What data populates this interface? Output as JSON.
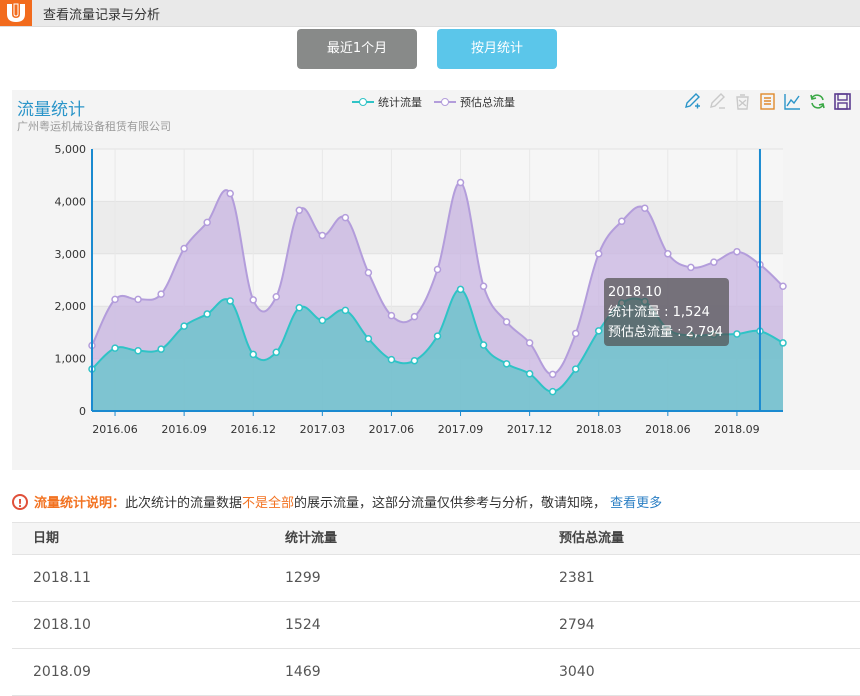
{
  "app": {
    "title": "查看流量记录与分析",
    "logo_icon": "brand-u-logo"
  },
  "tabs": {
    "recent": "最近1个月",
    "monthly": "按月统计"
  },
  "colors": {
    "primary_series": "#2fc3c6",
    "secondary_series": "#b39ddb",
    "accent": "#5bc6ea",
    "brand": "#f26b1d"
  },
  "toolbox": [
    "mark-pen-icon",
    "undo-mark-icon",
    "clear-mark-icon",
    "data-view-icon",
    "line-chart-icon",
    "refresh-icon",
    "save-image-icon"
  ],
  "chart": {
    "title": "流量统计",
    "subtitle": "广州粤运机械设备租赁有限公司",
    "tooltip": {
      "period": "2018.10",
      "line1": "统计流量 : 1,524",
      "line2": "预估总流量 : 2,794"
    }
  },
  "chart_data": {
    "type": "area",
    "title": "流量统计",
    "ylim": [
      0,
      5000
    ],
    "yticks": [
      "0",
      "1,000",
      "2,000",
      "3,000",
      "4,000",
      "5,000"
    ],
    "xticks": [
      "2016.06",
      "2016.09",
      "2016.12",
      "2017.03",
      "2017.06",
      "2017.09",
      "2017.12",
      "2018.03",
      "2018.06",
      "2018.09"
    ],
    "x": [
      "2016.05",
      "2016.06",
      "2016.07",
      "2016.08",
      "2016.09",
      "2016.10",
      "2016.11",
      "2016.12",
      "2017.01",
      "2017.02",
      "2017.03",
      "2017.04",
      "2017.05",
      "2017.06",
      "2017.07",
      "2017.08",
      "2017.09",
      "2017.10",
      "2017.11",
      "2017.12",
      "2018.01",
      "2018.02",
      "2018.03",
      "2018.04",
      "2018.05",
      "2018.06",
      "2018.07",
      "2018.08",
      "2018.09",
      "2018.10",
      "2018.11"
    ],
    "series": [
      {
        "name": "统计流量",
        "values": [
          800,
          1200,
          1150,
          1180,
          1620,
          1850,
          2100,
          1080,
          1120,
          1970,
          1730,
          1920,
          1380,
          980,
          960,
          1430,
          2320,
          1260,
          900,
          710,
          370,
          800,
          1530,
          2060,
          2090,
          1560,
          1440,
          1460,
          1469,
          1524,
          1299
        ]
      },
      {
        "name": "预估总流量",
        "values": [
          1250,
          2130,
          2130,
          2230,
          3100,
          3600,
          4150,
          2120,
          2180,
          3830,
          3350,
          3690,
          2640,
          1820,
          1800,
          2700,
          4360,
          2380,
          1700,
          1300,
          700,
          1480,
          3000,
          3620,
          3870,
          3000,
          2740,
          2840,
          3040,
          2794,
          2381
        ]
      }
    ],
    "legend": "top-center",
    "grid": true,
    "marker_at": "2018.10"
  },
  "notice": {
    "label": "流量统计说明：",
    "text1": "此次统计的流量数据",
    "warn": "不是全部",
    "text2": "的展示流量，这部分流量仅供参考与分析，敬请知晓，",
    "link": "查看更多"
  },
  "table": {
    "headers": [
      "日期",
      "统计流量",
      "预估总流量"
    ],
    "rows": [
      [
        "2018.11",
        "1299",
        "2381"
      ],
      [
        "2018.10",
        "1524",
        "2794"
      ],
      [
        "2018.09",
        "1469",
        "3040"
      ]
    ]
  }
}
